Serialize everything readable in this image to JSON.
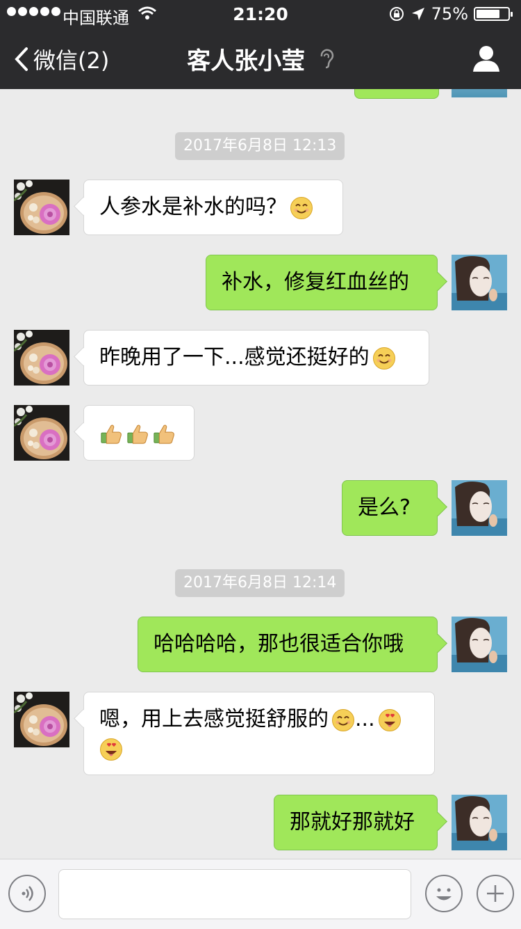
{
  "status_bar": {
    "carrier": "中国联通",
    "time": "21:20",
    "battery": "75%",
    "battery_level": 0.75
  },
  "nav": {
    "back_label": "微信(2)",
    "title": "客人张小莹"
  },
  "chat": {
    "timestamps": [
      "2017年6月8日 12:13",
      "2017年6月8日 12:14"
    ],
    "messages": [
      {
        "side": "left",
        "text": "人参水是补水的吗？"
      },
      {
        "side": "right",
        "text": "补水，修复红血丝的"
      },
      {
        "side": "left",
        "text": "昨晚用了一下...感觉还挺好的"
      },
      {
        "side": "left",
        "text": ""
      },
      {
        "side": "right",
        "text": "是么?"
      },
      {
        "side": "right",
        "text": "哈哈哈哈，那也很适合你哦"
      },
      {
        "side": "left",
        "text": "嗯，用上去感觉挺舒服的",
        "text2": "..."
      },
      {
        "side": "right",
        "text": "那就好那就好"
      }
    ]
  },
  "input_bar": {
    "voice_icon": "voice-icon",
    "emoji_icon": "emoji-icon",
    "plus_icon": "plus-icon",
    "value": ""
  },
  "colors": {
    "nav_bg": "#2b2b2d",
    "chat_bg": "#ebebeb",
    "sent_bubble": "#a0e75a",
    "received_bubble": "#ffffff",
    "timestamp_bg": "#cecece"
  }
}
